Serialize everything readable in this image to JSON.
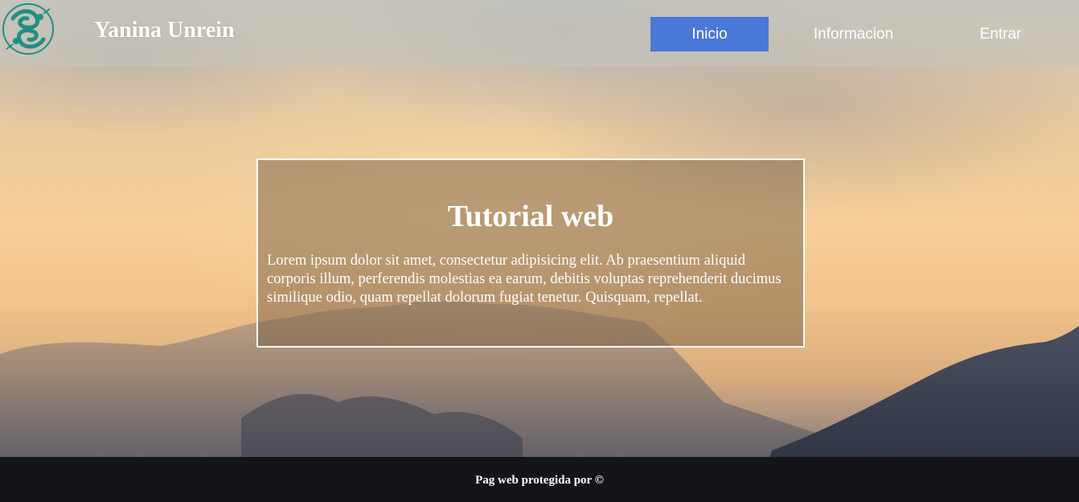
{
  "header": {
    "brand": "Yanina Unrein",
    "nav": [
      {
        "label": "Inicio",
        "active": true
      },
      {
        "label": "Informacion",
        "active": false
      },
      {
        "label": "Entrar",
        "active": false
      }
    ]
  },
  "hero": {
    "title": "Tutorial web",
    "text": "Lorem ipsum dolor sit amet, consectetur adipisicing elit. Ab praesentium aliquid corporis illum, perferendis molestias ea earum, debitis voluptas reprehenderit ducimus similique odio, quam repellat dolorum fugiat tenetur. Quisquam, repellat."
  },
  "footer": {
    "text": "Pag web protegida por ©"
  },
  "colors": {
    "active_nav": "#4a78d8",
    "footer_bg": "#121417",
    "logo_teal": "#1f8f86"
  },
  "icons": {
    "logo": "pisces-fish-logo-icon"
  }
}
